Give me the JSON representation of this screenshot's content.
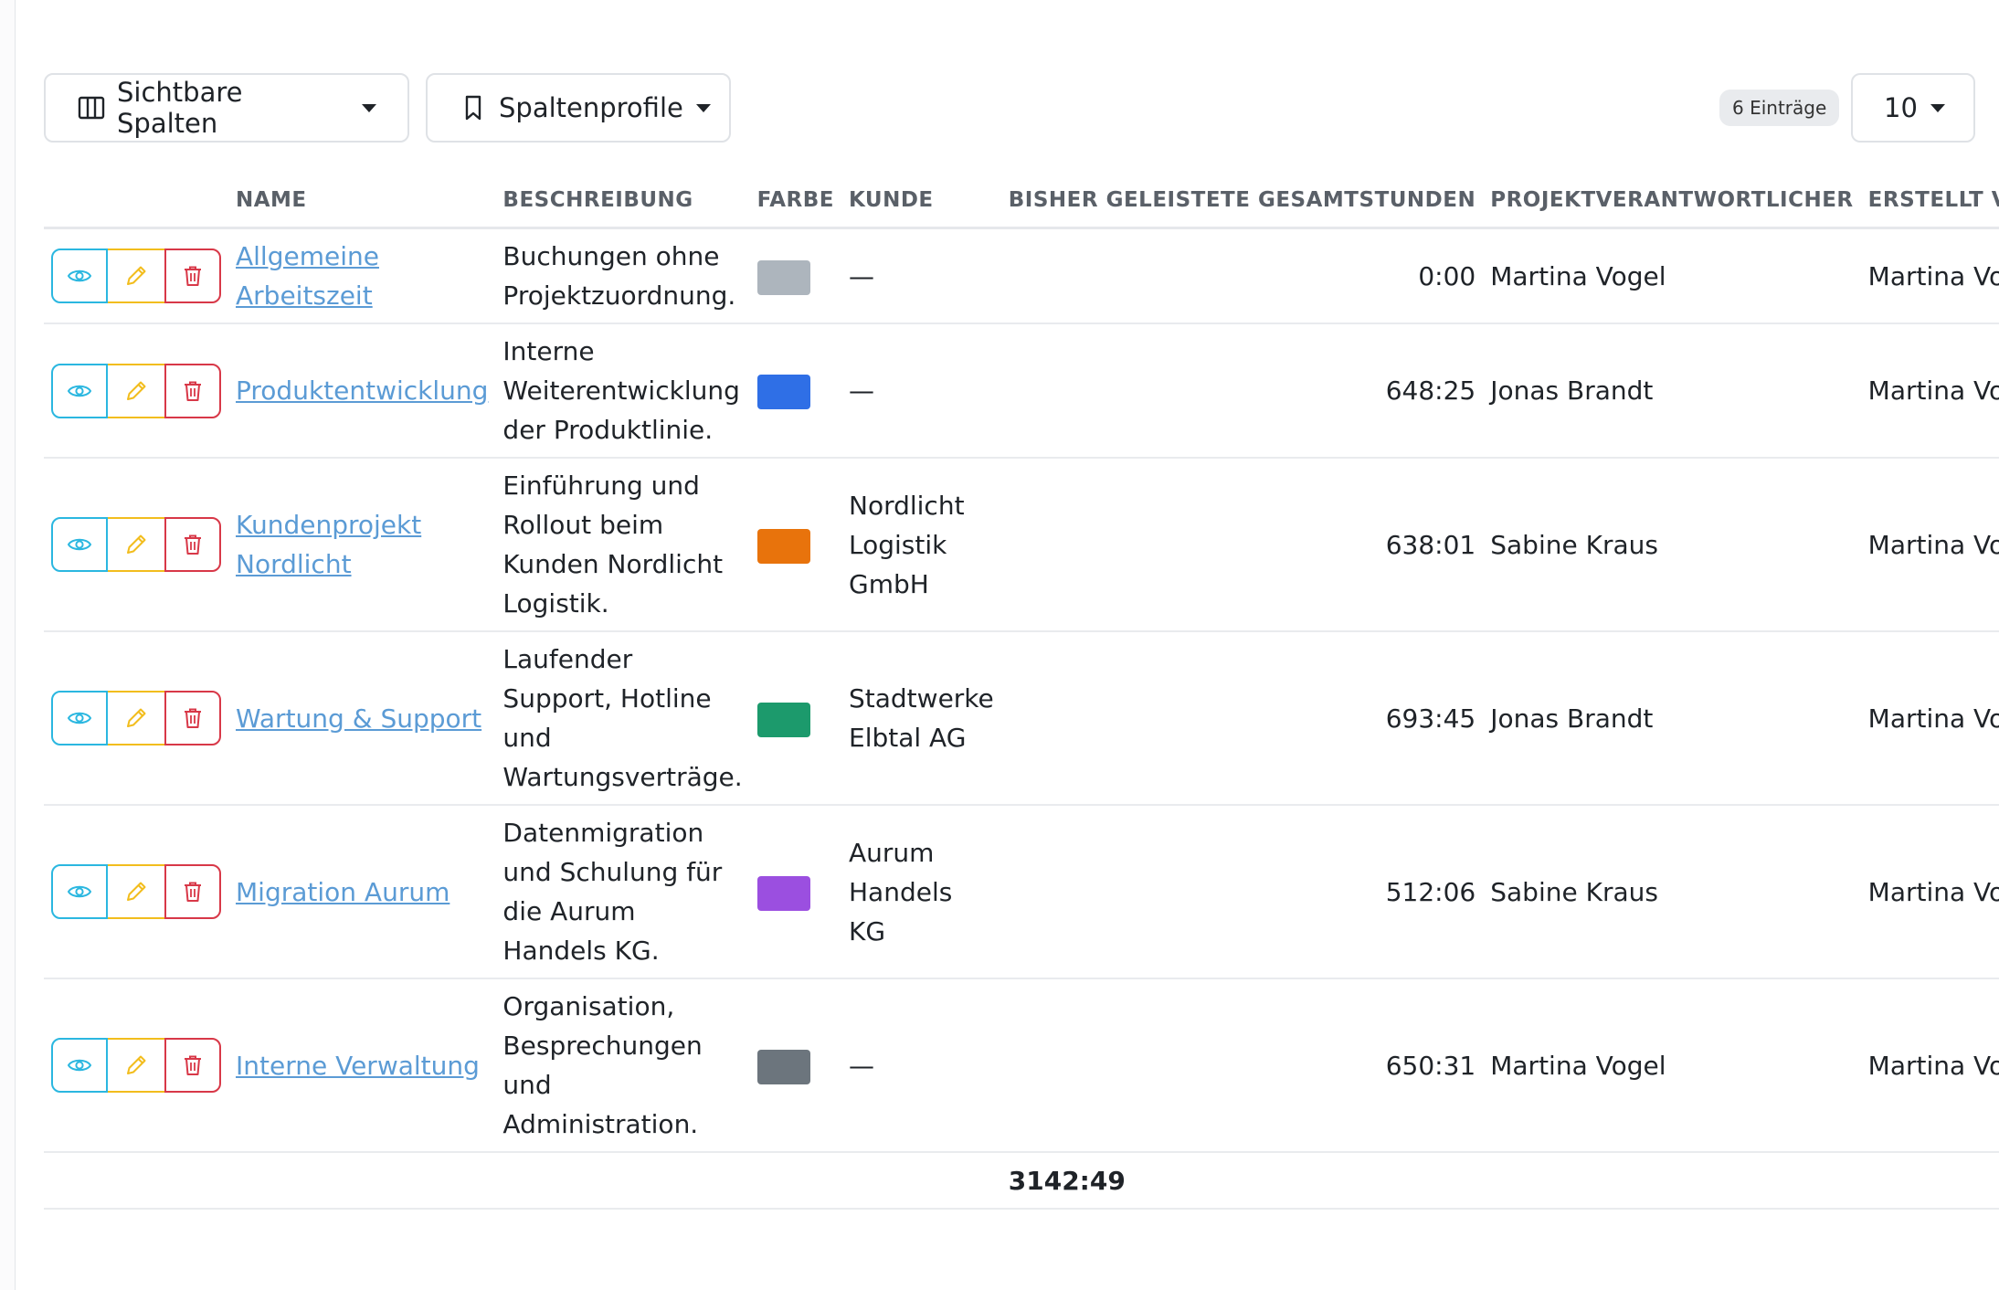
{
  "toolbar": {
    "visible_columns_label": "Sichtbare Spalten",
    "column_profiles_label": "Spaltenprofile",
    "entries_badge": "6 Einträge",
    "page_size": "10"
  },
  "table": {
    "headers": {
      "name": "NAME",
      "description": "BESCHREIBUNG",
      "color": "FARBE",
      "customer": "KUNDE",
      "hours": "BISHER GELEISTETE GESAMTSTUNDEN",
      "manager": "PROJEKTVERANTWORTLICHER",
      "created_by": "ERSTELLT VON"
    },
    "rows": [
      {
        "name": "Allgemeine Arbeitszeit",
        "description": "Buchungen ohne Projektzuordnung.",
        "color": "#adb5bd",
        "customer": "—",
        "hours": "0:00",
        "manager": "Martina Vogel",
        "created_by": "Martina Vogel"
      },
      {
        "name": "Produktentwicklung",
        "description": "Interne Weiterentwicklung der Produktlinie.",
        "color": "#2f6fe6",
        "customer": "—",
        "hours": "648:25",
        "manager": "Jonas Brandt",
        "created_by": "Martina Vogel"
      },
      {
        "name": "Kundenprojekt Nordlicht",
        "description": "Einführung und Rollout beim Kunden Nordlicht Logistik.",
        "color": "#e8730c",
        "customer": "Nordlicht Logistik GmbH",
        "hours": "638:01",
        "manager": "Sabine Kraus",
        "created_by": "Martina Vogel"
      },
      {
        "name": "Wartung & Support",
        "description": "Laufender Support, Hotline und Wartungsverträge.",
        "color": "#1c9a6c",
        "customer": "Stadtwerke Elbtal AG",
        "hours": "693:45",
        "manager": "Jonas Brandt",
        "created_by": "Martina Vogel"
      },
      {
        "name": "Migration Aurum",
        "description": "Datenmigration und Schulung für die Aurum Handels KG.",
        "color": "#9b4fe0",
        "customer": "Aurum Handels KG",
        "hours": "512:06",
        "manager": "Sabine Kraus",
        "created_by": "Martina Vogel"
      },
      {
        "name": "Interne Verwaltung",
        "description": "Organisation, Besprechungen und Administration.",
        "color": "#6c757d",
        "customer": "—",
        "hours": "650:31",
        "manager": "Martina Vogel",
        "created_by": "Martina Vogel"
      }
    ],
    "total_hours": "3142:49"
  },
  "icons": {
    "view": "eye-icon",
    "edit": "pencil-icon",
    "delete": "trash-icon",
    "columns": "columns-icon",
    "profiles": "bookmark-icon"
  }
}
